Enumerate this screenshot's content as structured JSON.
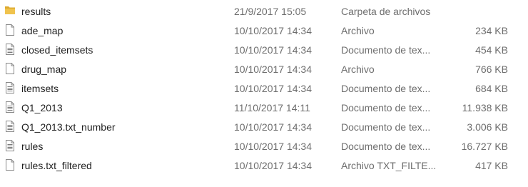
{
  "files": [
    {
      "name": "results",
      "date": "21/9/2017 15:05",
      "type": "Carpeta de archivos",
      "size": "",
      "icon": "folder-icon"
    },
    {
      "name": "ade_map",
      "date": "10/10/2017 14:34",
      "type": "Archivo",
      "size": "234 KB",
      "icon": "file-icon"
    },
    {
      "name": "closed_itemsets",
      "date": "10/10/2017 14:34",
      "type": "Documento de tex...",
      "size": "454 KB",
      "icon": "text-document-icon"
    },
    {
      "name": "drug_map",
      "date": "10/10/2017 14:34",
      "type": "Archivo",
      "size": "766 KB",
      "icon": "file-icon"
    },
    {
      "name": "itemsets",
      "date": "10/10/2017 14:34",
      "type": "Documento de tex...",
      "size": "684 KB",
      "icon": "text-document-icon"
    },
    {
      "name": "Q1_2013",
      "date": "11/10/2017 14:11",
      "type": "Documento de tex...",
      "size": "11.938 KB",
      "icon": "text-document-icon"
    },
    {
      "name": "Q1_2013.txt_number",
      "date": "10/10/2017 14:34",
      "type": "Documento de tex...",
      "size": "3.006 KB",
      "icon": "text-document-icon"
    },
    {
      "name": "rules",
      "date": "10/10/2017 14:34",
      "type": "Documento de tex...",
      "size": "16.727 KB",
      "icon": "text-document-icon"
    },
    {
      "name": "rules.txt_filtered",
      "date": "10/10/2017 14:34",
      "type": "Archivo TXT_FILTE...",
      "size": "417 KB",
      "icon": "file-icon"
    }
  ],
  "colors": {
    "folder": "#f0c34d",
    "folder_dark": "#dca92e",
    "file_outline": "#8a8a8a",
    "text_lines": "#7a7a7a",
    "secondary_text": "#6d6d6d"
  }
}
